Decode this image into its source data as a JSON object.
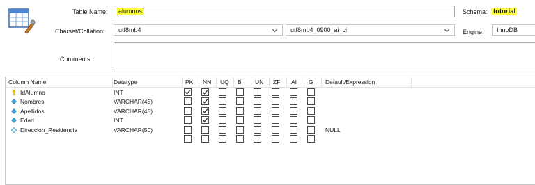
{
  "form": {
    "table_name_label": "Table Name:",
    "table_name_value": "alumnos",
    "schema_label": "Schema:",
    "schema_value": "tutorial",
    "charset_label": "Charset/Collation:",
    "charset_value": "utf8mb4",
    "collation_value": "utf8mb4_0900_ai_ci",
    "engine_label": "Engine:",
    "engine_value": "InnoDB",
    "comments_label": "Comments:",
    "comments_value": ""
  },
  "grid": {
    "headers": [
      "Column Name",
      "Datatype",
      "PK",
      "NN",
      "UQ",
      "B",
      "UN",
      "ZF",
      "AI",
      "G",
      "Default/Expression"
    ],
    "rows": [
      {
        "icon": "primary-key-icon",
        "name": "IdAlumno",
        "datatype": "INT",
        "flags": [
          true,
          true,
          false,
          false,
          false,
          false,
          false,
          false
        ],
        "default": ""
      },
      {
        "icon": "column-nn-icon",
        "name": "Nombres",
        "datatype": "VARCHAR(45)",
        "flags": [
          false,
          true,
          false,
          false,
          false,
          false,
          false,
          false
        ],
        "default": ""
      },
      {
        "icon": "column-nn-icon",
        "name": "Apellidos",
        "datatype": "VARCHAR(45)",
        "flags": [
          false,
          true,
          false,
          false,
          false,
          false,
          false,
          false
        ],
        "default": ""
      },
      {
        "icon": "column-nn-icon",
        "name": "Edad",
        "datatype": "INT",
        "flags": [
          false,
          true,
          false,
          false,
          false,
          false,
          false,
          false
        ],
        "default": ""
      },
      {
        "icon": "column-nullable-icon",
        "name": "Direccion_Residencia",
        "datatype": "VARCHAR(50)",
        "flags": [
          false,
          false,
          false,
          false,
          false,
          false,
          false,
          false
        ],
        "default": "NULL"
      },
      {
        "icon": "",
        "name": "",
        "datatype": "",
        "flags": [
          false,
          false,
          false,
          false,
          false,
          false,
          false,
          false
        ],
        "default": ""
      }
    ]
  },
  "colors": {
    "highlight": "#ffff3c",
    "key_icon": "#e8b800",
    "diamond_filled": "#3aa4d8",
    "checkbox_border": "#4a4a4a"
  }
}
